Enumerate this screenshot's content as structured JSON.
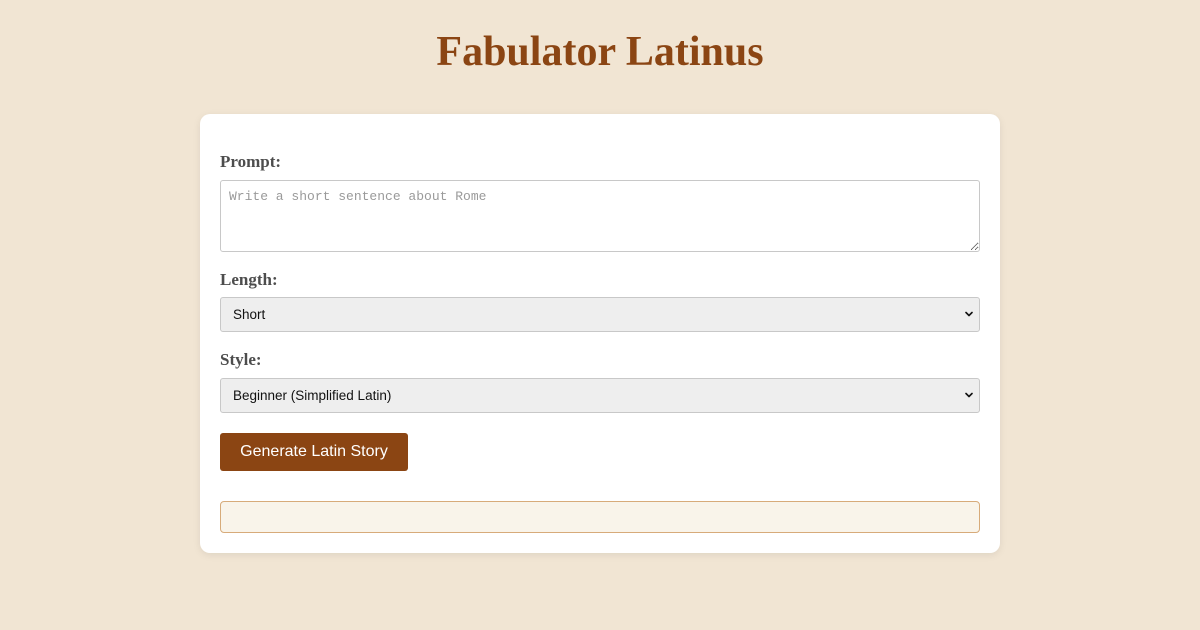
{
  "header": {
    "title": "Fabulator Latinus"
  },
  "form": {
    "prompt": {
      "label": "Prompt:",
      "placeholder": "Write a short sentence about Rome",
      "value": ""
    },
    "length": {
      "label": "Length:",
      "selected": "Short"
    },
    "style": {
      "label": "Style:",
      "selected": "Beginner (Simplified Latin)"
    },
    "generate_label": "Generate Latin Story"
  },
  "output": {
    "text": ""
  },
  "colors": {
    "page_background": "#f1e5d3",
    "accent_brown": "#8b4513",
    "card_background": "#ffffff",
    "output_background": "#f9f4ea",
    "output_border": "#d7ab7a"
  },
  "icons": {
    "select_arrow": "chevron-down-icon",
    "textarea_resize": "resize-grip-icon"
  }
}
